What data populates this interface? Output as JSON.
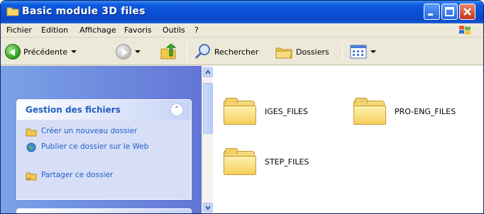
{
  "window": {
    "title": "Basic module 3D files"
  },
  "menu": {
    "items": [
      "Fichier",
      "Edition",
      "Affichage",
      "Favoris",
      "Outils",
      "?"
    ]
  },
  "toolbar": {
    "back_label": "Précédente",
    "search_label": "Rechercher",
    "folders_label": "Dossiers"
  },
  "taskpane": {
    "section_title": "Gestion des fichiers",
    "links": [
      {
        "label": "Créer un nouveau dossier",
        "icon": "new-folder-icon"
      },
      {
        "label": "Publier ce dossier sur le Web",
        "icon": "globe-icon"
      },
      {
        "label": "Partager ce dossier",
        "icon": "shared-folder-icon"
      }
    ]
  },
  "files": [
    {
      "name": "IGES_FILES",
      "icon": "folder-icon"
    },
    {
      "name": "PRO-ENG_FILES",
      "icon": "folder-icon"
    },
    {
      "name": "STEP_FILES",
      "icon": "folder-icon"
    }
  ],
  "colors": {
    "titlebar": "#0a4ed4",
    "taskpane_bg": "#7ba2e7",
    "link_text": "#215dc6",
    "folder": "#f4cf5c"
  }
}
